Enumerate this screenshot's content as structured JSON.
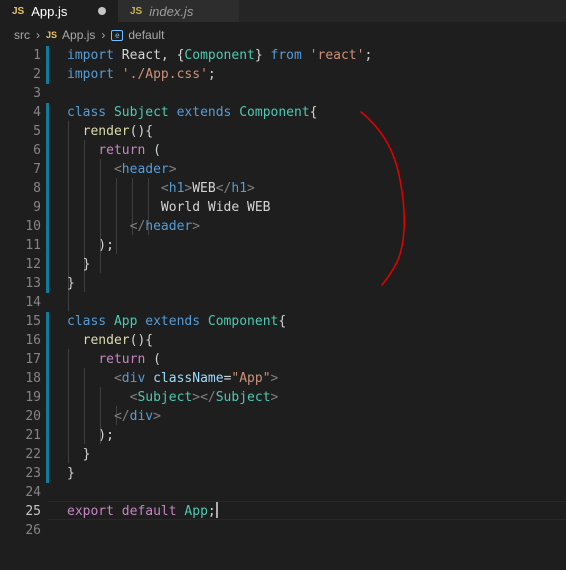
{
  "tabs": [
    {
      "icon": "JS",
      "label": "App.js",
      "modified": true,
      "active": true
    },
    {
      "icon": "JS",
      "label": "index.js",
      "modified": false,
      "active": false
    }
  ],
  "breadcrumb": {
    "folder": "src",
    "file_icon": "JS",
    "file": "App.js",
    "symbol": "default"
  },
  "editor": {
    "line_numbers": [
      "1",
      "2",
      "3",
      "4",
      "5",
      "6",
      "7",
      "8",
      "9",
      "10",
      "11",
      "12",
      "13",
      "14",
      "15",
      "16",
      "17",
      "18",
      "19",
      "20",
      "21",
      "22",
      "23",
      "24",
      "25",
      "26"
    ],
    "lines": [
      [
        {
          "c": "k",
          "t": "import"
        },
        {
          "c": "p",
          "t": " React, {"
        },
        {
          "c": "t",
          "t": "Component"
        },
        {
          "c": "p",
          "t": "} "
        },
        {
          "c": "k",
          "t": "from"
        },
        {
          "c": "p",
          "t": " "
        },
        {
          "c": "s",
          "t": "'react'"
        },
        {
          "c": "p",
          "t": ";"
        }
      ],
      [
        {
          "c": "k",
          "t": "import"
        },
        {
          "c": "p",
          "t": " "
        },
        {
          "c": "s",
          "t": "'./App.css'"
        },
        {
          "c": "p",
          "t": ";"
        }
      ],
      [],
      [
        {
          "c": "k",
          "t": "class"
        },
        {
          "c": "p",
          "t": " "
        },
        {
          "c": "t",
          "t": "Subject"
        },
        {
          "c": "p",
          "t": " "
        },
        {
          "c": "k",
          "t": "extends"
        },
        {
          "c": "p",
          "t": " "
        },
        {
          "c": "t",
          "t": "Component"
        },
        {
          "c": "p",
          "t": "{"
        }
      ],
      [
        {
          "c": "p",
          "t": "  "
        },
        {
          "c": "f",
          "t": "render"
        },
        {
          "c": "p",
          "t": "(){"
        }
      ],
      [
        {
          "c": "p",
          "t": "    "
        },
        {
          "c": "kc",
          "t": "return"
        },
        {
          "c": "p",
          "t": " ("
        }
      ],
      [
        {
          "c": "p",
          "t": "      "
        },
        {
          "c": "pu",
          "t": "<"
        },
        {
          "c": "tg",
          "t": "header"
        },
        {
          "c": "pu",
          "t": ">"
        }
      ],
      [
        {
          "c": "p",
          "t": "            "
        },
        {
          "c": "pu",
          "t": "<"
        },
        {
          "c": "tg",
          "t": "h1"
        },
        {
          "c": "pu",
          "t": ">"
        },
        {
          "c": "p",
          "t": "WEB"
        },
        {
          "c": "pu",
          "t": "</"
        },
        {
          "c": "tg",
          "t": "h1"
        },
        {
          "c": "pu",
          "t": ">"
        }
      ],
      [
        {
          "c": "p",
          "t": "            World Wide WEB"
        }
      ],
      [
        {
          "c": "p",
          "t": "        "
        },
        {
          "c": "pu",
          "t": "</"
        },
        {
          "c": "tg",
          "t": "header"
        },
        {
          "c": "pu",
          "t": ">"
        }
      ],
      [
        {
          "c": "p",
          "t": "    );"
        }
      ],
      [
        {
          "c": "p",
          "t": "  }"
        }
      ],
      [
        {
          "c": "p",
          "t": "}"
        }
      ],
      [],
      [
        {
          "c": "k",
          "t": "class"
        },
        {
          "c": "p",
          "t": " "
        },
        {
          "c": "t",
          "t": "App"
        },
        {
          "c": "p",
          "t": " "
        },
        {
          "c": "k",
          "t": "extends"
        },
        {
          "c": "p",
          "t": " "
        },
        {
          "c": "t",
          "t": "Component"
        },
        {
          "c": "p",
          "t": "{"
        }
      ],
      [
        {
          "c": "p",
          "t": "  "
        },
        {
          "c": "f",
          "t": "render"
        },
        {
          "c": "p",
          "t": "(){"
        }
      ],
      [
        {
          "c": "p",
          "t": "    "
        },
        {
          "c": "kc",
          "t": "return"
        },
        {
          "c": "p",
          "t": " ("
        }
      ],
      [
        {
          "c": "p",
          "t": "      "
        },
        {
          "c": "pu",
          "t": "<"
        },
        {
          "c": "tg",
          "t": "div"
        },
        {
          "c": "p",
          "t": " "
        },
        {
          "c": "ta",
          "t": "className"
        },
        {
          "c": "p",
          "t": "="
        },
        {
          "c": "s",
          "t": "\"App\""
        },
        {
          "c": "pu",
          "t": ">"
        }
      ],
      [
        {
          "c": "p",
          "t": "        "
        },
        {
          "c": "pu",
          "t": "<"
        },
        {
          "c": "t",
          "t": "Subject"
        },
        {
          "c": "pu",
          "t": "></"
        },
        {
          "c": "t",
          "t": "Subject"
        },
        {
          "c": "pu",
          "t": ">"
        }
      ],
      [
        {
          "c": "p",
          "t": "      "
        },
        {
          "c": "pu",
          "t": "</"
        },
        {
          "c": "tg",
          "t": "div"
        },
        {
          "c": "pu",
          "t": ">"
        }
      ],
      [
        {
          "c": "p",
          "t": "    );"
        }
      ],
      [
        {
          "c": "p",
          "t": "  }"
        }
      ],
      [
        {
          "c": "p",
          "t": "}"
        }
      ],
      [],
      [
        {
          "c": "kc",
          "t": "export"
        },
        {
          "c": "p",
          "t": " "
        },
        {
          "c": "kc",
          "t": "default"
        },
        {
          "c": "p",
          "t": " "
        },
        {
          "c": "t",
          "t": "App"
        },
        {
          "c": "p",
          "t": ";"
        }
      ],
      []
    ],
    "modified_lines": [
      "1",
      "2",
      "4",
      "5",
      "6",
      "7",
      "8",
      "9",
      "10",
      "11",
      "12",
      "13",
      "15",
      "16",
      "17",
      "18",
      "19",
      "20",
      "21",
      "22",
      "23"
    ],
    "cursor_line": "25"
  },
  "colors": {
    "background": "#1e1e1e",
    "tab_bar": "#252526",
    "keyword": "#569cd6",
    "control_keyword": "#c586c0",
    "type": "#4ec9b0",
    "function": "#dcdcaa",
    "string": "#ce9178",
    "attribute": "#9cdcfe",
    "gutter_modified": "#0c7d9d",
    "annotation_ink": "#e00000"
  }
}
